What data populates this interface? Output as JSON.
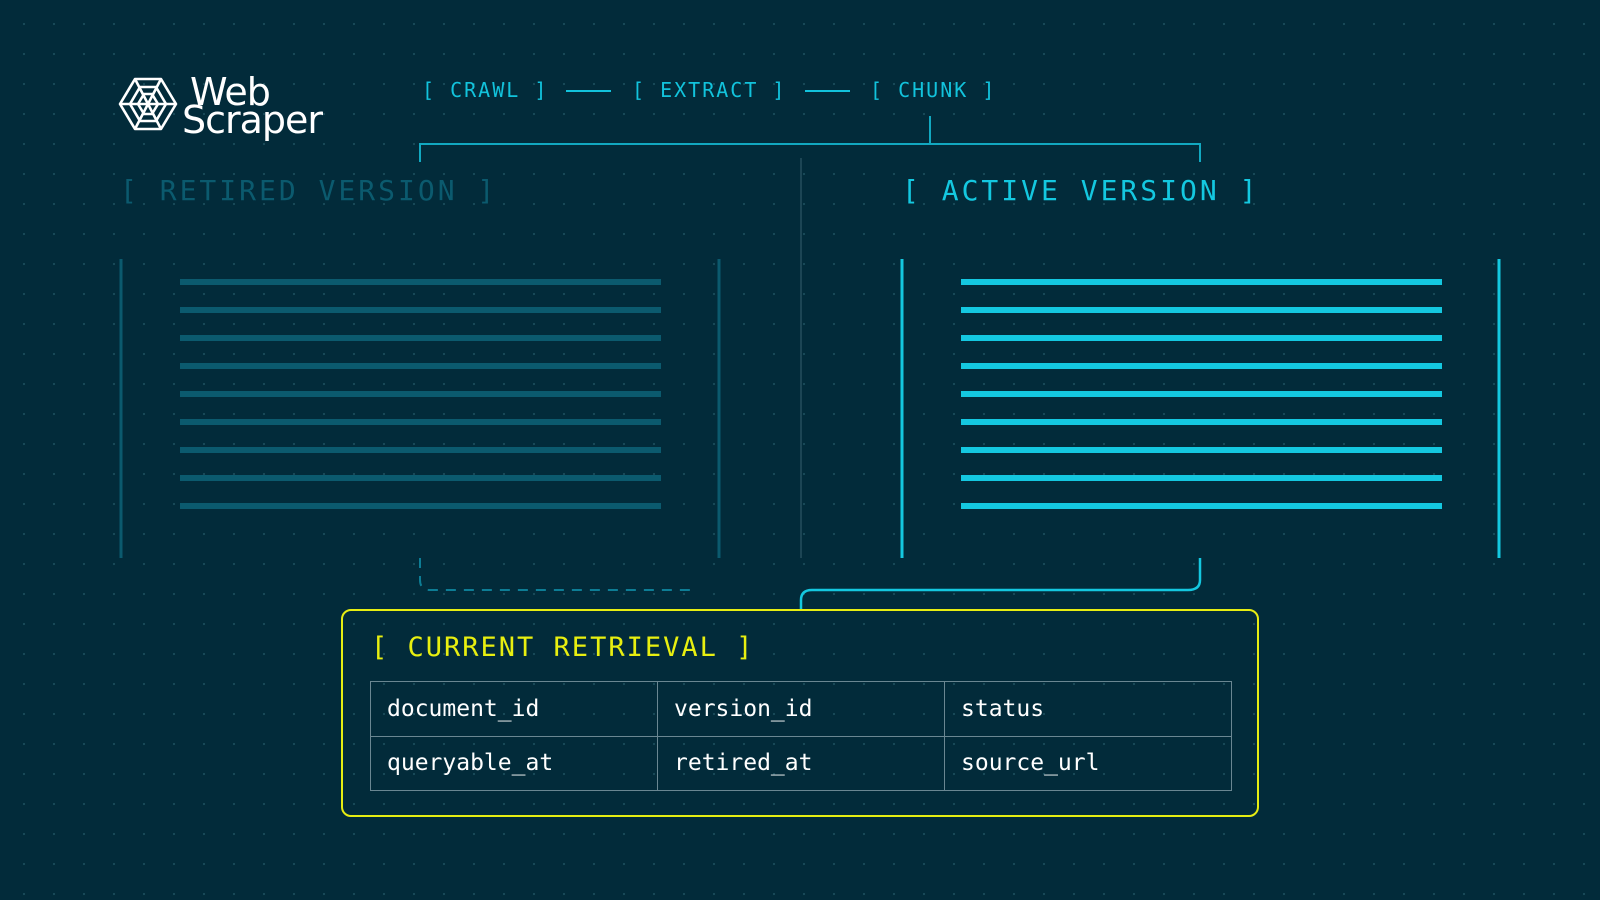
{
  "logo": {
    "line1": "Web",
    "line2": "Scraper",
    "icon": "spider-web-icon"
  },
  "pipeline": {
    "stages": [
      "[ CRAWL ]",
      "[ EXTRACT ]",
      "[ CHUNK ]"
    ]
  },
  "versions": {
    "retired": {
      "title": "[ RETIRED VERSION ]"
    },
    "active": {
      "title": "[ ACTIVE VERSION ]"
    }
  },
  "retrieval": {
    "title": "[ CURRENT RETRIEVAL ]",
    "fields": [
      [
        "document_id",
        "version_id",
        "status"
      ],
      [
        "queryable_at",
        "retired_at",
        "source_url"
      ]
    ]
  },
  "colors": {
    "background": "#022b3a",
    "active": "#14c8e0",
    "retired": "#0b5a6e",
    "highlight": "#e6ed12"
  }
}
